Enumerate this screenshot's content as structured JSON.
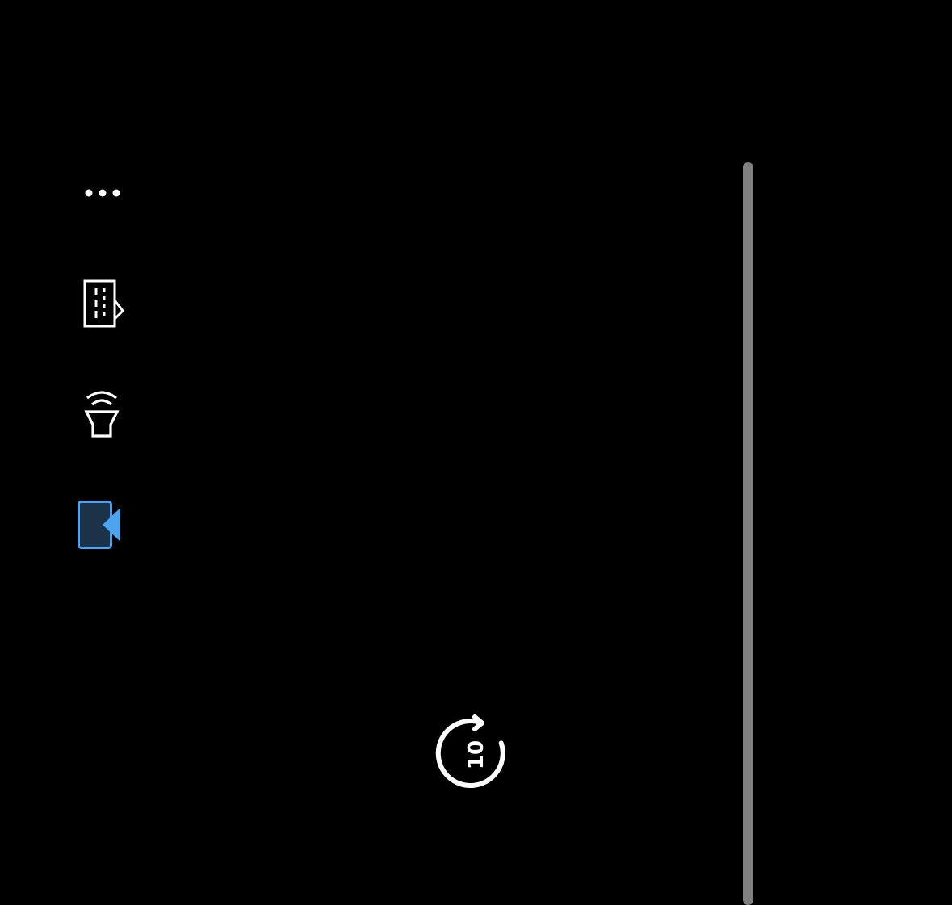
{
  "player": {
    "side_controls": [
      {
        "id": "more",
        "icon": "more-horizontal-icon"
      },
      {
        "id": "episodes",
        "icon": "episodes-list-icon"
      },
      {
        "id": "cast",
        "icon": "cast-broadcast-icon"
      },
      {
        "id": "picture-in-picture",
        "icon": "pip-collapse-icon",
        "active": true
      }
    ],
    "skip": {
      "icon": "skip-forward-icon",
      "seconds": "10"
    },
    "colors": {
      "background": "#000000",
      "icon": "#ffffff",
      "accent": "#4da3ee",
      "accent_fill": "#1b3248",
      "scrubber_track": "#808080"
    }
  }
}
